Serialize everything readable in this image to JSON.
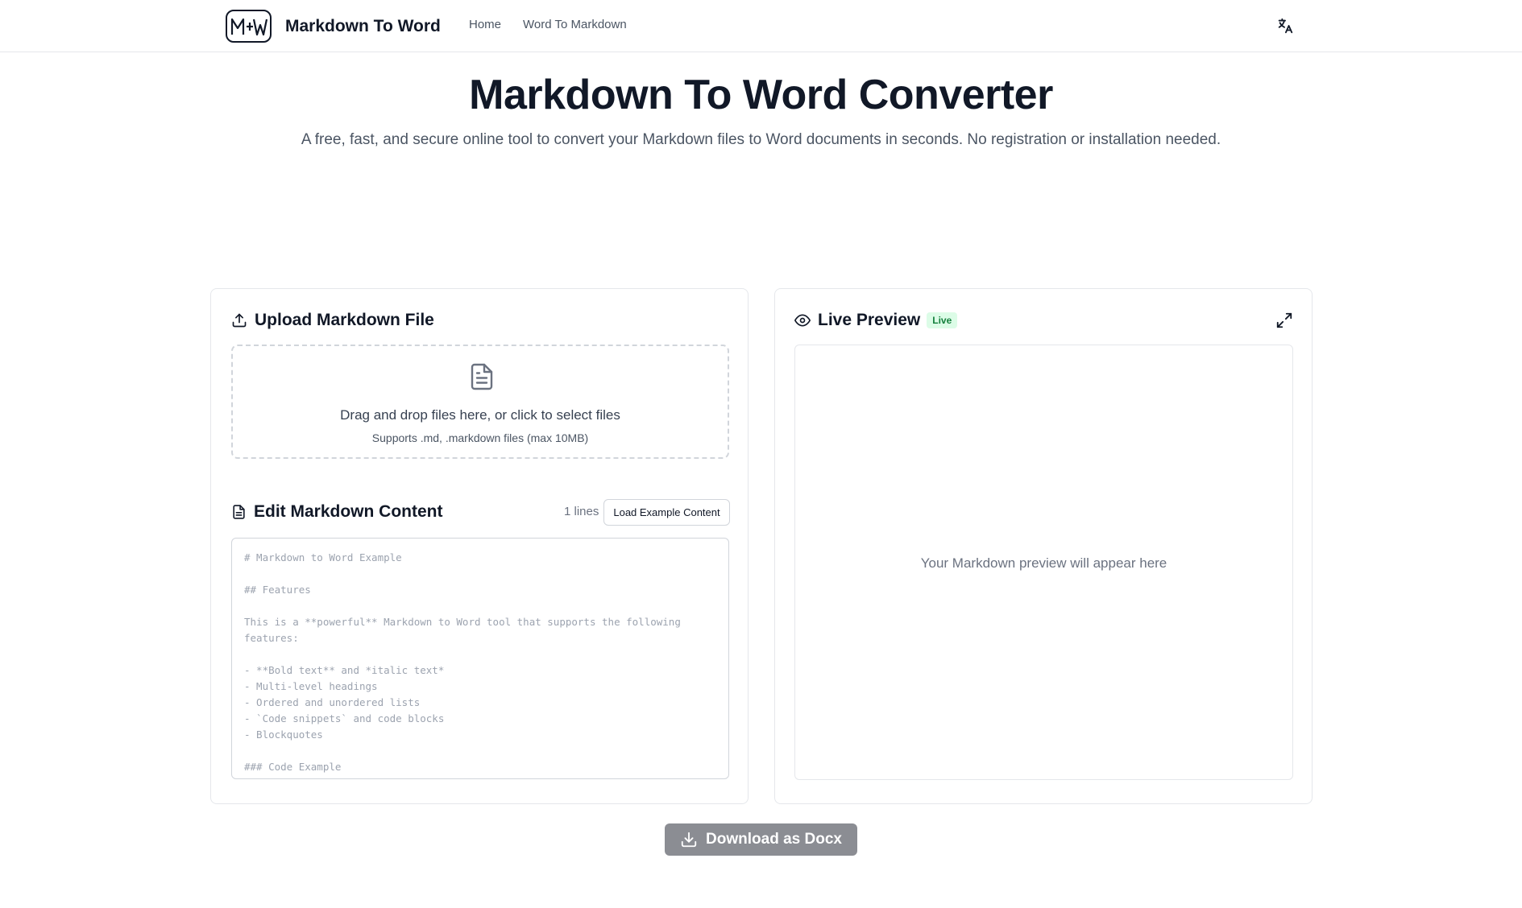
{
  "header": {
    "logo_text": "M↔W",
    "brand_name": "Markdown To Word",
    "nav": [
      "Home",
      "Word To Markdown"
    ],
    "language_icon": "translate-icon"
  },
  "hero": {
    "title": "Markdown To Word Converter",
    "subtitle": "A free, fast, and secure online tool to convert your Markdown files to Word documents in seconds. No registration or installation needed."
  },
  "upload": {
    "title": "Upload Markdown File",
    "icon": "upload-icon",
    "drop_text": "Drag and drop files here, or click to select files",
    "supports_text": "Supports .md, .markdown files (max 10MB)",
    "file_icon": "file-text-icon"
  },
  "editor": {
    "title": "Edit Markdown Content",
    "icon": "file-text-icon",
    "lines_count": "1 lines",
    "load_example_label": "Load Example Content",
    "placeholder_lines": [
      "# Markdown to Word Example",
      "",
      "## Features",
      "",
      "This is a **powerful** Markdown to Word tool that supports the following",
      "features:",
      "",
      "- **Bold text** and *italic text*",
      "- Multi-level headings",
      "- Ordered and unordered lists",
      "- `Code snippets` and code blocks",
      "- Blockquotes",
      "",
      "### Code Example"
    ]
  },
  "preview": {
    "title": "Live Preview",
    "icon": "eye-icon",
    "badge": "Live",
    "expand_icon": "expand-icon",
    "placeholder": "Your Markdown preview will appear here"
  },
  "download": {
    "label": "Download as Docx",
    "icon": "download-icon",
    "color": "#8b8d93"
  },
  "colors": {
    "text_primary": "#111827",
    "text_secondary": "#4b5563",
    "border": "#e5e7eb",
    "live_badge_bg": "#dcfce7",
    "live_badge_text": "#15803d"
  }
}
